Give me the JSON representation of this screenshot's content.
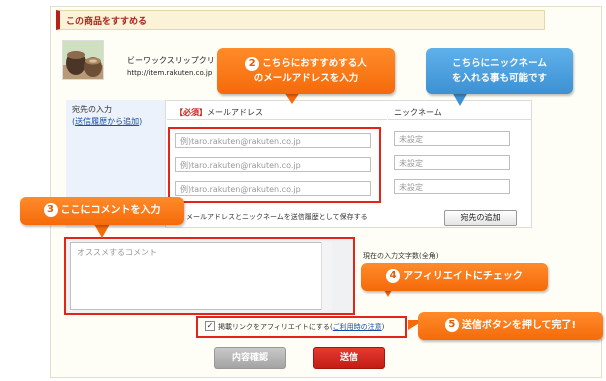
{
  "section": {
    "title": "この商品をすすめる"
  },
  "product": {
    "name": "ビーワックスリップクリ",
    "url": "http://item.rakuten.co.jp"
  },
  "destination": {
    "label": "宛先の入力",
    "history_link_open": "(",
    "history_link": "送信履歴から追加",
    "history_link_close": ")"
  },
  "columns": {
    "required": "【必須】",
    "email": "メールアドレス",
    "nickname": "ニックネーム"
  },
  "rows": [
    {
      "email_placeholder": "例)taro.rakuten@rakuten.co.jp",
      "nickname_placeholder": "未設定"
    },
    {
      "email_placeholder": "例)taro.rakuten@rakuten.co.jp",
      "nickname_placeholder": "未設定"
    },
    {
      "email_placeholder": "例)taro.rakuten@rakuten.co.jp",
      "nickname_placeholder": "未設定"
    }
  ],
  "save_note": "メールアドレスとニックネームを送信履歴として保存する",
  "add_destination_button": "宛先の追加",
  "comment": {
    "placeholder": "オススメするコメント",
    "char_count_label": "現在の入力文字数(全角)"
  },
  "affiliate": {
    "label": "掲載リンクをアフィリエイトにする",
    "link_open": "(",
    "link": "ご利用時の注意",
    "link_close": ")",
    "checked": true,
    "check_glyph": "✓"
  },
  "buttons": {
    "confirm": "内容確認",
    "send": "送信"
  },
  "callouts": {
    "c2": {
      "num": "2",
      "line1": "こちらにおすすめする人",
      "line2": "のメールアドレスを入力"
    },
    "nickname": {
      "line1": "こちらにニックネーム",
      "line2": "を入れる事も可能です"
    },
    "c3": {
      "num": "3",
      "text": "ここにコメントを入力"
    },
    "c4": {
      "num": "4",
      "text": "アフィリエイトにチェック"
    },
    "c5": {
      "num": "5",
      "text": "送信ボタンを押して完了!"
    }
  },
  "colors": {
    "accent_red": "#e32418",
    "callout_orange": "#f56a0a",
    "callout_blue": "#3d91d3",
    "link_blue": "#1a4fa8"
  }
}
